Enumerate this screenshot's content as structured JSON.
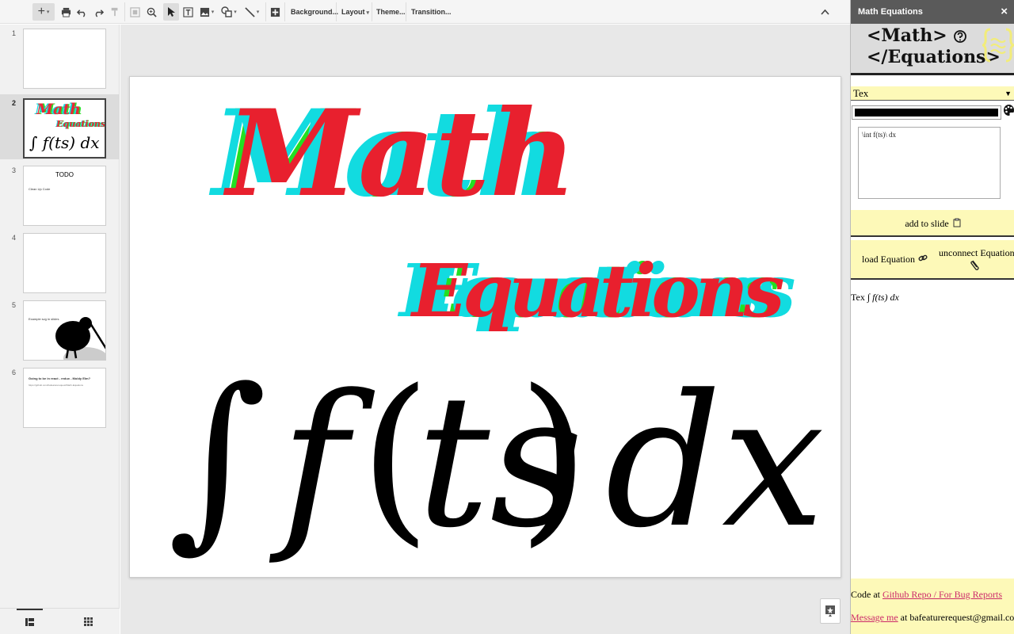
{
  "toolbar": {
    "background_label": "Background...",
    "layout_label": "Layout",
    "theme_label": "Theme...",
    "transition_label": "Transition..."
  },
  "slides": [
    {
      "num": "1"
    },
    {
      "num": "2",
      "title_line1": "Math",
      "title_line2": "Equations",
      "formula": "∫ f(ts) dx"
    },
    {
      "num": "3",
      "title": "TODO",
      "text": "Clean Up Code"
    },
    {
      "num": "4"
    },
    {
      "num": "5",
      "text": "Example svg in slides"
    },
    {
      "num": "6",
      "title": "Going to be in react - redux - Moldy Elm?",
      "text": "https://github.com/bafeaturerequest/Math-Equations"
    }
  ],
  "slide": {
    "title": "Math",
    "subtitle": "Equations",
    "formula_int": "∫",
    "formula_f": "f",
    "formula_open": "(",
    "formula_ts": "ts",
    "formula_close": ")",
    "formula_dx": "dx"
  },
  "panel": {
    "header": "Math Equations",
    "close": "×",
    "banner_line1": "<Math>",
    "banner_line2": "</Equations>",
    "type_value": "Tex",
    "latex_value": "\\int f(ts)\\ dx",
    "add_label": "add to slide",
    "load_label": "load Equation",
    "unconnect_label": "unconnect Equation",
    "preview_prefix": "Tex",
    "preview_math": "∫ f(ts) dx",
    "footer_code_prefix": "Code at ",
    "footer_link1": "Github Repo / For Bug Reports",
    "footer_link2": "Message me",
    "footer_suffix": " at bafeaturerequest@gmail.com"
  }
}
